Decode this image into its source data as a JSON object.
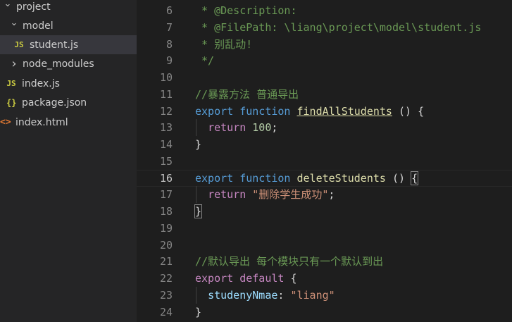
{
  "explorer": {
    "items": [
      {
        "label": "project",
        "type": "folder",
        "expanded": true,
        "chevron": "chevron-down-icon"
      },
      {
        "label": "model",
        "type": "folder",
        "expanded": true,
        "chevron": "chevron-down-icon"
      },
      {
        "label": "student.js",
        "type": "file",
        "icon_text": "JS",
        "selected": true
      },
      {
        "label": "node_modules",
        "type": "folder",
        "expanded": false,
        "chevron": "chevron-right-icon"
      },
      {
        "label": "index.js",
        "type": "file",
        "icon_text": "JS"
      },
      {
        "label": "package.json",
        "type": "file",
        "icon_text": "{}"
      },
      {
        "label": "index.html",
        "type": "file",
        "icon_text": "<>"
      }
    ]
  },
  "editor": {
    "active_line": 16,
    "lines": [
      {
        "n": "6",
        "tokens": [
          {
            "t": " * @Description:",
            "c": "comment"
          }
        ]
      },
      {
        "n": "7",
        "tokens": [
          {
            "t": " * @FilePath: \\liang\\project\\model\\student.js",
            "c": "comment"
          }
        ]
      },
      {
        "n": "8",
        "tokens": [
          {
            "t": " * 别乱动!",
            "c": "comment"
          }
        ]
      },
      {
        "n": "9",
        "tokens": [
          {
            "t": " */",
            "c": "comment"
          }
        ]
      },
      {
        "n": "10",
        "tokens": []
      },
      {
        "n": "11",
        "tokens": [
          {
            "t": "//暴露方法 普通导出",
            "c": "comment"
          }
        ]
      },
      {
        "n": "12",
        "tokens": [
          {
            "t": "export",
            "c": "kw"
          },
          {
            "t": " ",
            "c": "punc"
          },
          {
            "t": "function",
            "c": "kw"
          },
          {
            "t": " ",
            "c": "punc"
          },
          {
            "t": "findAllStudents",
            "c": "fn-link"
          },
          {
            "t": " () {",
            "c": "punc"
          }
        ]
      },
      {
        "n": "13",
        "tokens": [
          {
            "t": "  ",
            "c": "punc"
          },
          {
            "t": "return",
            "c": "ctrl"
          },
          {
            "t": " ",
            "c": "punc"
          },
          {
            "t": "100",
            "c": "num"
          },
          {
            "t": ";",
            "c": "punc"
          }
        ]
      },
      {
        "n": "14",
        "tokens": [
          {
            "t": "}",
            "c": "punc"
          }
        ]
      },
      {
        "n": "15",
        "tokens": []
      },
      {
        "n": "16",
        "tokens": [
          {
            "t": "export",
            "c": "kw"
          },
          {
            "t": " ",
            "c": "punc"
          },
          {
            "t": "function",
            "c": "kw"
          },
          {
            "t": " ",
            "c": "punc"
          },
          {
            "t": "deleteStudents",
            "c": "fn"
          },
          {
            "t": " () ",
            "c": "punc"
          },
          {
            "t": "{",
            "c": "bracket"
          }
        ]
      },
      {
        "n": "17",
        "tokens": [
          {
            "t": "  ",
            "c": "punc"
          },
          {
            "t": "return",
            "c": "ctrl"
          },
          {
            "t": " ",
            "c": "punc"
          },
          {
            "t": "\"删除学生成功\"",
            "c": "str"
          },
          {
            "t": ";",
            "c": "punc"
          }
        ]
      },
      {
        "n": "18",
        "tokens": [
          {
            "t": "}",
            "c": "bracket"
          }
        ]
      },
      {
        "n": "19",
        "tokens": []
      },
      {
        "n": "20",
        "tokens": []
      },
      {
        "n": "21",
        "tokens": [
          {
            "t": "//默认导出 每个模块只有一个默认到出",
            "c": "comment"
          }
        ]
      },
      {
        "n": "22",
        "tokens": [
          {
            "t": "export",
            "c": "ctrl"
          },
          {
            "t": " ",
            "c": "punc"
          },
          {
            "t": "default",
            "c": "ctrl"
          },
          {
            "t": " {",
            "c": "punc"
          }
        ]
      },
      {
        "n": "23",
        "tokens": [
          {
            "t": "  ",
            "c": "punc"
          },
          {
            "t": "studenyNmae",
            "c": "prop"
          },
          {
            "t": ": ",
            "c": "punc"
          },
          {
            "t": "\"liang\"",
            "c": "str"
          }
        ]
      },
      {
        "n": "24",
        "tokens": [
          {
            "t": "}",
            "c": "punc"
          }
        ]
      }
    ]
  },
  "colors": {
    "editor_bg": "#1e1e1e",
    "sidebar_bg": "#252526",
    "selected_row": "#37373d",
    "comment": "#6a9955",
    "keyword": "#569cd6",
    "control": "#c586c0",
    "function": "#dcdcaa",
    "number": "#b5cea8",
    "string": "#ce9178",
    "property": "#9cdcfe"
  }
}
